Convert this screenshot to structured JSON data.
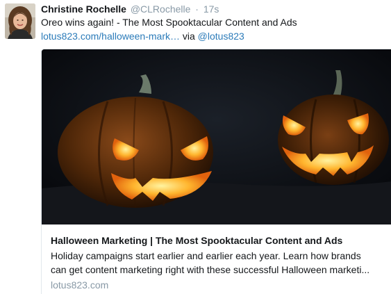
{
  "tweet": {
    "author_name": "Christine Rochelle",
    "author_handle": "@CLRochelle",
    "separator": "·",
    "timestamp": "17s",
    "text_line1": "Oreo wins again! - The Most Spooktacular Content and Ads",
    "link_text": "lotus823.com/halloween-mark…",
    "via_text": " via ",
    "mention": "@lotus823"
  },
  "card": {
    "title": "Halloween Marketing | The Most Spooktacular Content and Ads",
    "description_line1": "Holiday campaigns start earlier and earlier each year. Learn how brands",
    "description_line2": "can get content marketing right with these successful Halloween marketi...",
    "domain": "lotus823.com"
  },
  "colors": {
    "link": "#2b7bb9",
    "muted": "#8899a6",
    "text": "#14171a",
    "card_border": "#e1e8ed"
  },
  "icons": {
    "avatar": "profile-photo-woman",
    "card_image": "jack-o-lantern-photo"
  }
}
